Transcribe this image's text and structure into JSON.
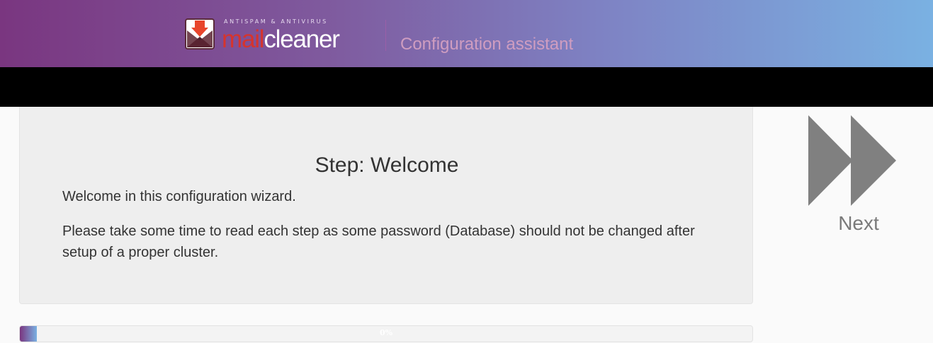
{
  "header": {
    "logo_tagline": "ANTISPAM & ANTIVIRUS",
    "logo_word_mail": "mail",
    "logo_word_cleaner": "cleaner",
    "title": "Configuration assistant"
  },
  "step": {
    "title": "Step: Welcome",
    "welcome": "Welcome in this configuration wizard.",
    "info": "Please take some time to read each step as some password (Database) should not be changed after setup of a proper cluster."
  },
  "nav": {
    "next_label": "Next",
    "next_icon": "fast-forward-icon"
  },
  "progress": {
    "value": 0,
    "label": "0%"
  },
  "colors": {
    "header_start": "#7a3680",
    "header_end": "#7ab1e2",
    "logo_red": "#d6342d",
    "next_gray": "#808080"
  }
}
